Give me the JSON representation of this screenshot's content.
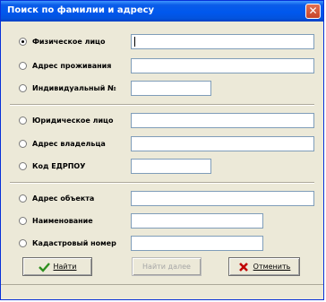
{
  "window": {
    "title": "Поиск по фамилии и адресу",
    "close_label": "✕"
  },
  "rows": [
    {
      "label": "Физическое лицо",
      "checked": true
    },
    {
      "label": "Адрес проживания",
      "checked": false
    },
    {
      "label": "Индивидуальный №",
      "checked": false
    },
    {
      "label": "Юридическое лицо",
      "checked": false
    },
    {
      "label": "Адрес владельца",
      "checked": false
    },
    {
      "label": "Код ЕДРПОУ",
      "checked": false
    },
    {
      "label": "Адрес объекта",
      "checked": false
    },
    {
      "label": "Наименование",
      "checked": false
    },
    {
      "label": "Кадастровый номер",
      "checked": false
    }
  ],
  "fields": [
    "",
    "",
    "",
    "",
    "",
    "",
    "",
    "",
    ""
  ],
  "buttons": {
    "find": "Найти",
    "find_next": "Найти далее",
    "cancel": "Отменить"
  },
  "colors": {
    "title_bar": "#0058ee",
    "find_icon": "#2d8f1e",
    "cancel_icon": "#c00000"
  }
}
